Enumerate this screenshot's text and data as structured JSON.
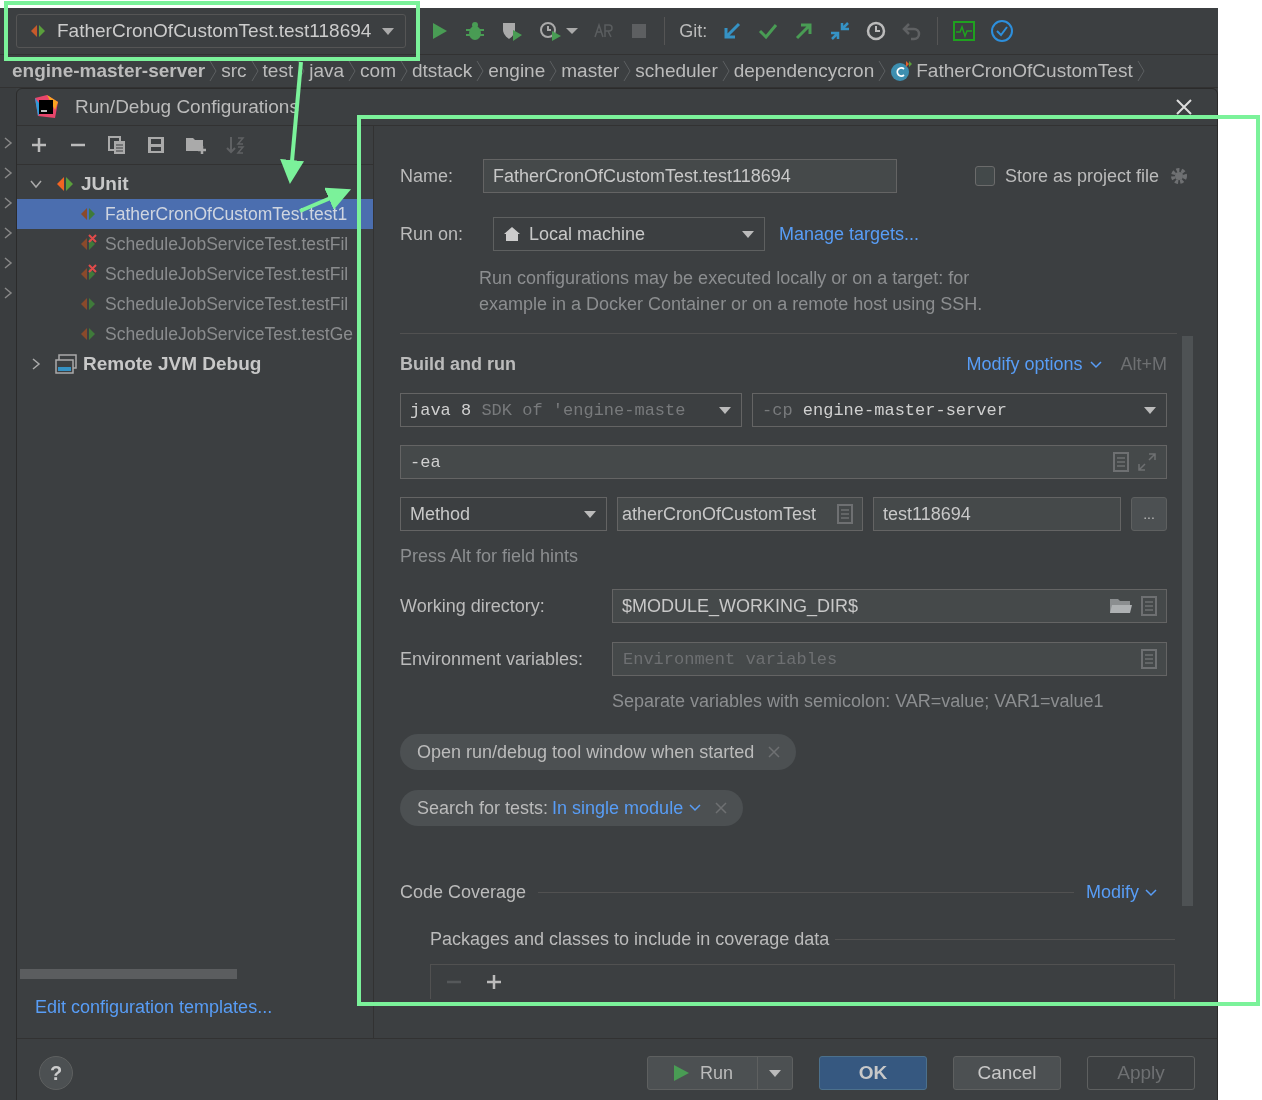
{
  "toolbar": {
    "run_config": "FatherCronOfCustomTest.test118694",
    "git_label": "Git:"
  },
  "breadcrumbs": [
    {
      "label": "engine-master-server",
      "kind": "module"
    },
    {
      "label": "src",
      "kind": "folder"
    },
    {
      "label": "test",
      "kind": "folder"
    },
    {
      "label": "java",
      "kind": "folder"
    },
    {
      "label": "com",
      "kind": "folder"
    },
    {
      "label": "dtstack",
      "kind": "folder"
    },
    {
      "label": "engine",
      "kind": "folder"
    },
    {
      "label": "master",
      "kind": "folder"
    },
    {
      "label": "scheduler",
      "kind": "folder"
    },
    {
      "label": "dependencycron",
      "kind": "folder"
    },
    {
      "label": "FatherCronOfCustomTest",
      "kind": "class"
    }
  ],
  "dialog": {
    "title": "Run/Debug Configurations"
  },
  "tree": [
    {
      "label": "JUnit",
      "kind": "junit",
      "expanded": true,
      "selected": false,
      "children": [
        {
          "label": "FatherCronOfCustomTest.test1",
          "selected": true,
          "failed": false
        },
        {
          "label": "ScheduleJobServiceTest.testFil",
          "selected": false,
          "failed": true
        },
        {
          "label": "ScheduleJobServiceTest.testFil",
          "selected": false,
          "failed": true
        },
        {
          "label": "ScheduleJobServiceTest.testFil",
          "selected": false,
          "failed": false
        },
        {
          "label": "ScheduleJobServiceTest.testGe",
          "selected": false,
          "failed": false
        }
      ]
    },
    {
      "label": "Remote JVM Debug",
      "kind": "remote",
      "expanded": false,
      "selected": false
    }
  ],
  "edit_templates_link": "Edit configuration templates...",
  "form": {
    "name_label": "Name:",
    "name_value": "FatherCronOfCustomTest.test118694",
    "store": {
      "label": "Store as project file",
      "checked": false
    },
    "run_on_label": "Run on:",
    "run_on_value": "Local machine",
    "manage_targets": "Manage targets...",
    "run_on_hint": "Run configurations may be executed locally or on a target: for example in a Docker Container or on a remote host using SSH.",
    "section": "Build and run",
    "modify_options": "Modify options",
    "shortcut": "Alt+M",
    "jre": {
      "main": "java 8",
      "hint": "SDK of 'engine-maste"
    },
    "classpath": {
      "prefix": "-cp",
      "value": "engine-master-server"
    },
    "vm_options": "-ea",
    "test_kind": "Method",
    "class_value": "atherCronOfCustomTest",
    "method_value": "test118694",
    "more": "...",
    "field_hints": "Press Alt for field hints",
    "working_dir_label": "Working directory:",
    "working_dir_value": "$MODULE_WORKING_DIR$",
    "env_label": "Environment variables:",
    "env_placeholder": "Environment variables",
    "env_hint": "Separate variables with semicolon: VAR=value; VAR1=value1",
    "chips": [
      {
        "label": "Open run/debug tool window when started"
      },
      {
        "label": "Search for tests:",
        "value": "In single module"
      }
    ],
    "coverage_title": "Code Coverage",
    "coverage_modify": "Modify",
    "coverage_packages": "Packages and classes to include in coverage data",
    "minus_disabled": true
  },
  "footer": {
    "help": "?",
    "run": "Run",
    "ok": "OK",
    "cancel": "Cancel",
    "apply": {
      "label": "Apply",
      "disabled": true
    }
  }
}
